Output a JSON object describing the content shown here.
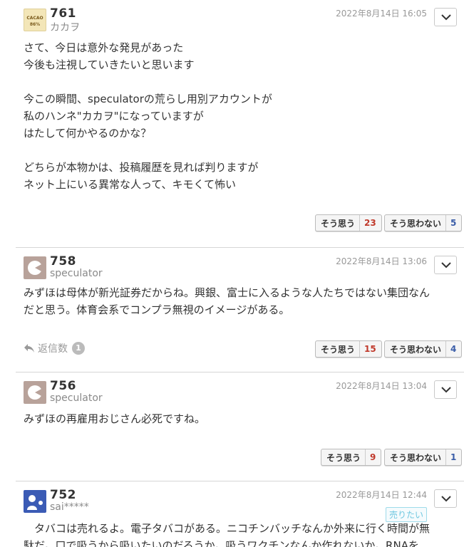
{
  "comments": [
    {
      "number": "761",
      "username": "カカヲ",
      "avatar_text": "CACAO 86%",
      "date": "2022年8月14日 16:05",
      "body": "さて、今日は意外な発見があった\n今後も注視していきたいと思います\n\n今この瞬間、speculatorの荒らし用別アカウントが\n私のハンネ\"カカヲ\"になっていますが\nはたして何かやるのかな？\n\nどちらが本物かは、投稿履歴を見れば判りますが\nネット上にいる異常な人って、キモくて怖い",
      "agree_label": "そう思う",
      "agree_count": "23",
      "disagree_label": "そう思わない",
      "disagree_count": "5"
    },
    {
      "number": "758",
      "username": "speculator",
      "date": "2022年8月14日 13:06",
      "body": "みずほは母体が新光証券だからね。興銀、富士に入るような人たちではない集団なん\nだと思う。体育会系でコンプラ無視のイメージがある。",
      "replies_label": "返信数",
      "replies_count": "1",
      "agree_label": "そう思う",
      "agree_count": "15",
      "disagree_label": "そう思わない",
      "disagree_count": "4"
    },
    {
      "number": "756",
      "username": "speculator",
      "date": "2022年8月14日 13:04",
      "body": "みずほの再雇用おじさん必死ですね。",
      "agree_label": "そう思う",
      "agree_count": "9",
      "disagree_label": "そう思わない",
      "disagree_count": "1"
    },
    {
      "number": "752",
      "username": "sai*****",
      "date": "2022年8月14日 12:44",
      "tag": "売りたい",
      "body": "　タバコは売れるよ。電子タバコがある。ニコチンバッチなんか外来に行く時間が無\n駄だ。口で吸うから吸いたいのだろうか。吸うワクチンなんか作れないか。RNAを"
    }
  ],
  "colors": {
    "agree_count": "#c0392b",
    "disagree_count": "#3a5da8",
    "tag": "#6fc7e0"
  }
}
